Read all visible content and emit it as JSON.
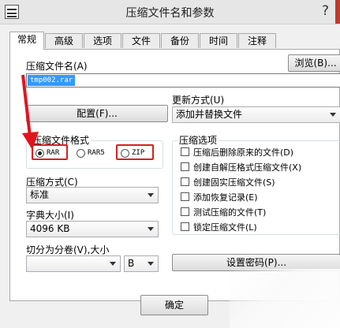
{
  "window": {
    "title": "压缩文件名和参数",
    "help": "?"
  },
  "tabs": [
    {
      "label": "常规"
    },
    {
      "label": "高级"
    },
    {
      "label": "选项"
    },
    {
      "label": "文件"
    },
    {
      "label": "备份"
    },
    {
      "label": "时间"
    },
    {
      "label": "注释"
    }
  ],
  "general": {
    "archive_name_label": "压缩文件名(A)",
    "archive_name_value": "tmp002.rar",
    "browse_label": "浏览(B)...",
    "profiles_label": "配置(F)...",
    "update_mode_label": "更新方式(U)",
    "update_mode_value": "添加并替换文件",
    "format_group_label": "压缩文件格式",
    "formats": [
      {
        "label": "RAR",
        "selected": true
      },
      {
        "label": "RAR5",
        "selected": false
      },
      {
        "label": "ZIP",
        "selected": false
      }
    ],
    "method_label": "压缩方式(C)",
    "method_value": "标准",
    "dict_label": "字典大小(I)",
    "dict_value": "4096 KB",
    "split_label": "切分为分卷(V),大小",
    "split_value": "",
    "split_unit": "B",
    "options_group_label": "压缩选项",
    "options": [
      {
        "label": "压缩后删除原来的文件(D)",
        "checked": false
      },
      {
        "label": "创建自解压格式压缩文件(X)",
        "checked": false
      },
      {
        "label": "创建固实压缩文件(S)",
        "checked": false
      },
      {
        "label": "添加恢复记录(E)",
        "checked": false
      },
      {
        "label": "测试压缩的文件(T)",
        "checked": false
      },
      {
        "label": "锁定压缩文件(L)",
        "checked": false
      }
    ],
    "password_label": "设置密码(P)..."
  },
  "footer": {
    "ok_label": "确定"
  },
  "colors": {
    "highlight": "#d62020",
    "arrow": "#e0141e",
    "selection": "#3399ff"
  }
}
